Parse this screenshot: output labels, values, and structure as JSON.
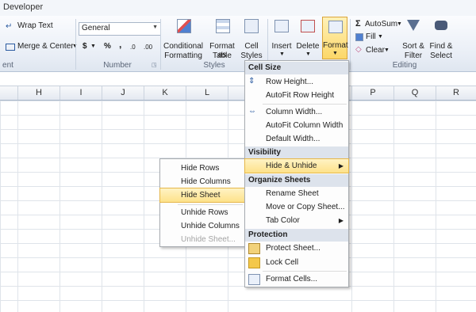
{
  "tab": {
    "developer": "Developer"
  },
  "ribbon": {
    "wrap_text": "Wrap Text",
    "merge_center": "Merge & Center",
    "number_format": "General",
    "currency": "$",
    "percent": "%",
    "comma": ",",
    "inc_decimal": ".0",
    "dec_decimal": ".00",
    "group_alignment_tail": "ent",
    "group_number": "Number",
    "group_styles": "Styles",
    "group_editing": "Editing",
    "conditional_formatting": [
      "Conditional",
      "Formatting"
    ],
    "format_as_table": [
      "Format as",
      "Table"
    ],
    "cell_styles": [
      "Cell",
      "Styles"
    ],
    "insert": "Insert",
    "delete": "Delete",
    "format": "Format",
    "autosum": "AutoSum",
    "fill": "Fill",
    "clear": "Clear",
    "sort_filter": [
      "Sort &",
      "Filter"
    ],
    "find_select": [
      "Find &",
      "Select"
    ]
  },
  "columns": [
    "H",
    "I",
    "J",
    "K",
    "L",
    "P",
    "Q",
    "R"
  ],
  "format_menu": {
    "cell_size": "Cell Size",
    "row_height": "Row Height...",
    "autofit_row": "AutoFit Row Height",
    "column_width": "Column Width...",
    "autofit_column": "AutoFit Column Width",
    "default_width": "Default Width...",
    "visibility": "Visibility",
    "hide_unhide": "Hide & Unhide",
    "organize_sheets": "Organize Sheets",
    "rename_sheet": "Rename Sheet",
    "move_copy": "Move or Copy Sheet...",
    "tab_color": "Tab Color",
    "protection": "Protection",
    "protect_sheet": "Protect Sheet...",
    "lock_cell": "Lock Cell",
    "format_cells": "Format Cells..."
  },
  "submenu": {
    "hide_rows": "Hide Rows",
    "hide_columns": "Hide Columns",
    "hide_sheet": "Hide Sheet",
    "unhide_rows": "Unhide Rows",
    "unhide_columns": "Unhide Columns",
    "unhide_sheet": "Unhide Sheet..."
  },
  "colors": {
    "highlight": "#fde28a",
    "menu_header": "#dde3ec",
    "ribbon": "#e9eef6"
  }
}
